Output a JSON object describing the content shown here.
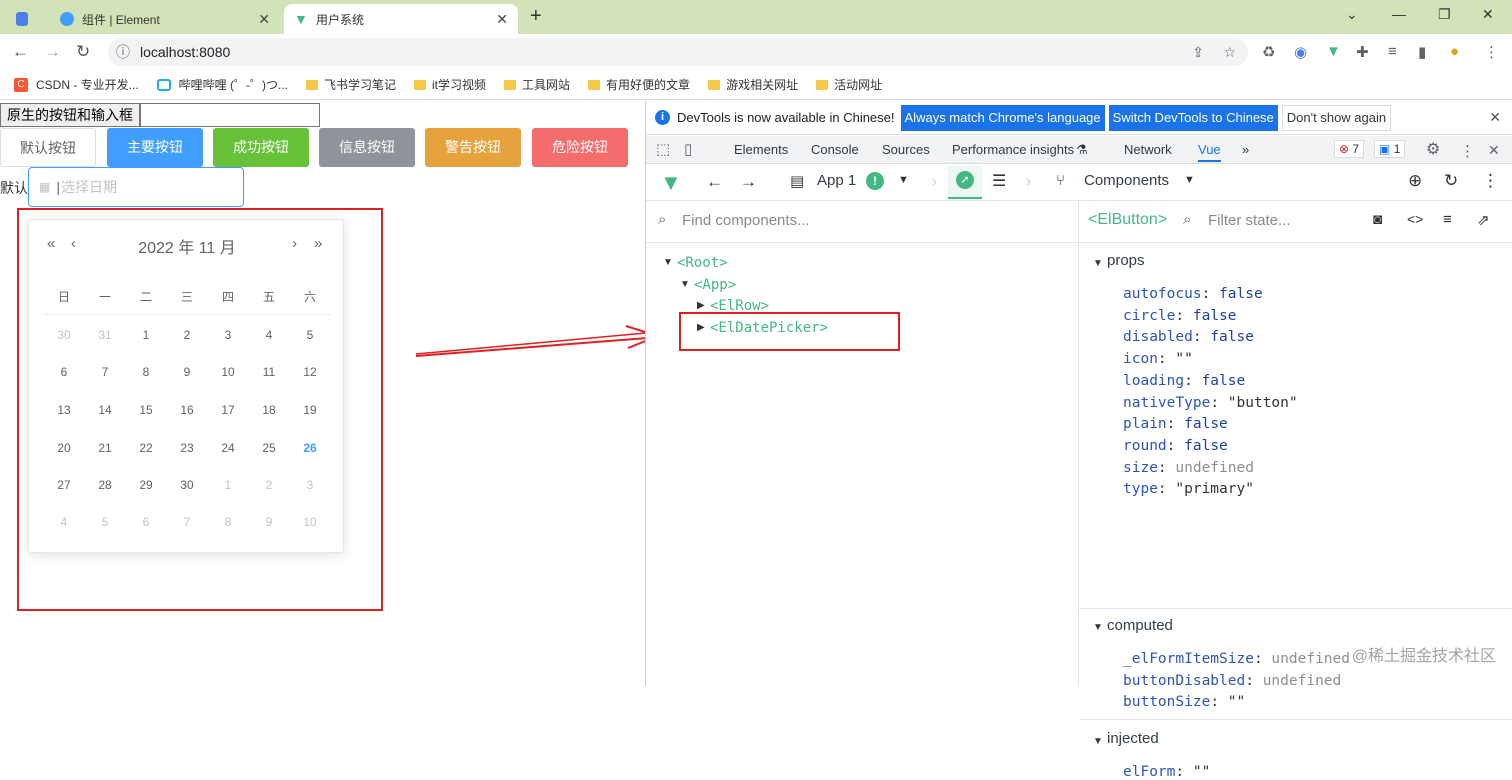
{
  "browser": {
    "tabs": [
      {
        "title": "",
        "active": false
      },
      {
        "title": "组件 | Element",
        "active": false
      },
      {
        "title": "用户系统",
        "active": true
      }
    ],
    "new_tab": "+",
    "url": "localhost:8080",
    "bookmarks": [
      "CSDN - 专业开发...",
      "哔哩哔哩 (゜-゜)つ...",
      "飞书学习笔记",
      "it学习视频",
      "工具网站",
      "有用好便的文章",
      "游戏相关网址",
      "活动网址"
    ]
  },
  "page": {
    "native_button": "原生的按钮和输入框",
    "buttons": {
      "default": "默认按钮",
      "primary": "主要按钮",
      "success": "成功按钮",
      "info": "信息按钮",
      "warning": "警告按钮",
      "danger": "危险按钮"
    },
    "date_label": "默认",
    "date_placeholder": "选择日期",
    "calendar": {
      "header": "2022 年  11 月",
      "weekdays": [
        "日",
        "一",
        "二",
        "三",
        "四",
        "五",
        "六"
      ],
      "weeks": [
        [
          "30",
          "31",
          "1",
          "2",
          "3",
          "4",
          "5"
        ],
        [
          "6",
          "7",
          "8",
          "9",
          "10",
          "11",
          "12"
        ],
        [
          "13",
          "14",
          "15",
          "16",
          "17",
          "18",
          "19"
        ],
        [
          "20",
          "21",
          "22",
          "23",
          "24",
          "25",
          "26"
        ],
        [
          "27",
          "28",
          "29",
          "30",
          "1",
          "2",
          "3"
        ],
        [
          "4",
          "5",
          "6",
          "7",
          "8",
          "9",
          "10"
        ]
      ],
      "today": "26"
    }
  },
  "devtools": {
    "info_text": "DevTools is now available in Chinese!",
    "info_btn1": "Always match Chrome's language",
    "info_btn2": "Switch DevTools to Chinese",
    "info_btn3": "Don't show again",
    "tabs": [
      "Elements",
      "Console",
      "Sources",
      "Performance insights",
      "Network",
      "Vue"
    ],
    "active_tab": "Vue",
    "errors": "7",
    "messages": "1",
    "vue": {
      "app": "App 1",
      "components": "Components",
      "find_placeholder": "Find components...",
      "selected": "<ElButton>",
      "filter_placeholder": "Filter state...",
      "tree": [
        "<Root>",
        "<App>",
        "<ElRow>",
        "<ElDatePicker>"
      ],
      "sections": {
        "props": "props",
        "computed": "computed",
        "injected": "injected"
      },
      "props": [
        {
          "key": "autofocus",
          "value": "false"
        },
        {
          "key": "circle",
          "value": "false"
        },
        {
          "key": "disabled",
          "value": "false"
        },
        {
          "key": "icon",
          "value": "\"\""
        },
        {
          "key": "loading",
          "value": "false"
        },
        {
          "key": "nativeType",
          "value": "\"button\""
        },
        {
          "key": "plain",
          "value": "false"
        },
        {
          "key": "round",
          "value": "false"
        },
        {
          "key": "size",
          "value": "undefined"
        },
        {
          "key": "type",
          "value": "\"primary\""
        }
      ],
      "computed": [
        {
          "key": "_elFormItemSize",
          "value": "undefined"
        },
        {
          "key": "buttonDisabled",
          "value": "undefined"
        },
        {
          "key": "buttonSize",
          "value": "\"\""
        }
      ],
      "injected": [
        {
          "key": "elForm",
          "value": "\"\""
        }
      ]
    }
  },
  "watermark": "@稀土掘金技术社区",
  "colors": {
    "primary": "#409eff",
    "success": "#67c23a",
    "info": "#909399",
    "warning": "#e6a23c",
    "danger": "#f56c6c",
    "vue_green": "#42b883",
    "annotation_red": "#e02020"
  }
}
